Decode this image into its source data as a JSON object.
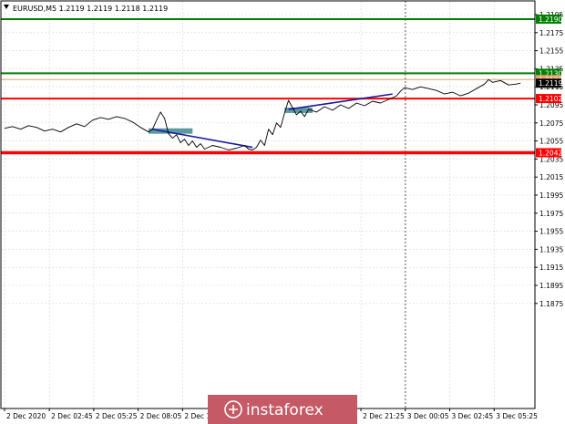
{
  "chart_data": {
    "type": "line",
    "title": "EURUSD,M5  1.2119 1.2119 1.2118 1.2119",
    "symbol_timeframe": "EURUSD,M5",
    "ohlc": [
      "1.2119",
      "1.2119",
      "1.2118",
      "1.2119"
    ],
    "ylim": [
      1.2862,
      1.2209
    ],
    "y_ticks": [
      "1.2195",
      "1.2175",
      "1.2155",
      "1.2135",
      "1.2115",
      "1.2095",
      "1.2075",
      "1.2055",
      "1.2035",
      "1.2015",
      "1.1995",
      "1.1975",
      "1.1955",
      "1.1935",
      "1.1915",
      "1.1895",
      "1.1875"
    ],
    "y_tick_values": [
      1.2195,
      1.2175,
      1.2155,
      1.2135,
      1.2115,
      1.2095,
      1.2075,
      1.2055,
      1.2035,
      1.2015,
      1.1995,
      1.1975,
      1.1955,
      1.1935,
      1.1915,
      1.1895,
      1.1875
    ],
    "x_range": [
      0,
      100
    ],
    "x_ticks": [
      {
        "label": "2 Dec 2020",
        "x": 0
      },
      {
        "label": "2 Dec 02:45",
        "x": 11.2
      },
      {
        "label": "2 Dec 05:25",
        "x": 22.3
      },
      {
        "label": "2 Dec 08:05",
        "x": 33.4
      },
      {
        "label": "2 Dec 10:45",
        "x": 44.5
      },
      {
        "label": "2 Dec 21:25",
        "x": 89.1
      },
      {
        "label": "3 Dec 00:05",
        "x": 100.2
      },
      {
        "label": "3 Dec 02:45",
        "x": 111.3
      },
      {
        "label": "3 Dec 05:25",
        "x": 122.4
      }
    ],
    "x_domain": [
      0,
      131
    ],
    "day_separator_x": 100.2,
    "grid": true,
    "price_series": [
      [
        0,
        1.2069
      ],
      [
        2,
        1.2071
      ],
      [
        4,
        1.2068
      ],
      [
        6,
        1.2072
      ],
      [
        8,
        1.207
      ],
      [
        10,
        1.2066
      ],
      [
        12,
        1.2068
      ],
      [
        14,
        1.2065
      ],
      [
        16,
        1.207
      ],
      [
        18,
        1.2074
      ],
      [
        20,
        1.2071
      ],
      [
        22,
        1.2078
      ],
      [
        24,
        1.2081
      ],
      [
        26,
        1.2079
      ],
      [
        28,
        1.2082
      ],
      [
        30,
        1.208
      ],
      [
        32,
        1.2076
      ],
      [
        34,
        1.207
      ],
      [
        36,
        1.2065
      ],
      [
        37,
        1.2068
      ],
      [
        38,
        1.2078
      ],
      [
        39,
        1.2087
      ],
      [
        40,
        1.208
      ],
      [
        41,
        1.2063
      ],
      [
        42,
        1.2058
      ],
      [
        43,
        1.2062
      ],
      [
        44,
        1.2053
      ],
      [
        45,
        1.2057
      ],
      [
        46,
        1.205
      ],
      [
        47,
        1.2055
      ],
      [
        48,
        1.2048
      ],
      [
        49,
        1.2052
      ],
      [
        50,
        1.2046
      ],
      [
        52,
        1.205
      ],
      [
        54,
        1.2048
      ],
      [
        56,
        1.2045
      ],
      [
        58,
        1.2047
      ],
      [
        60,
        1.205
      ],
      [
        61,
        1.2046
      ],
      [
        62,
        1.2045
      ],
      [
        63,
        1.2048
      ],
      [
        64,
        1.2056
      ],
      [
        65,
        1.205
      ],
      [
        66,
        1.2068
      ],
      [
        67,
        1.2062
      ],
      [
        68,
        1.2075
      ],
      [
        69,
        1.207
      ],
      [
        70,
        1.2086
      ],
      [
        71,
        1.21
      ],
      [
        72,
        1.2092
      ],
      [
        73,
        1.2084
      ],
      [
        74,
        1.2088
      ],
      [
        75,
        1.2082
      ],
      [
        76,
        1.209
      ],
      [
        78,
        1.2087
      ],
      [
        80,
        1.2093
      ],
      [
        82,
        1.2089
      ],
      [
        84,
        1.2095
      ],
      [
        86,
        1.2091
      ],
      [
        88,
        1.2097
      ],
      [
        90,
        1.2094
      ],
      [
        92,
        1.2099
      ],
      [
        94,
        1.2097
      ],
      [
        96,
        1.2101
      ],
      [
        98,
        1.2105
      ],
      [
        99,
        1.211
      ],
      [
        100,
        1.2114
      ],
      [
        102,
        1.2112
      ],
      [
        104,
        1.2115
      ],
      [
        106,
        1.2113
      ],
      [
        108,
        1.2111
      ],
      [
        110,
        1.2107
      ],
      [
        112,
        1.2109
      ],
      [
        114,
        1.2105
      ],
      [
        116,
        1.2108
      ],
      [
        118,
        1.2113
      ],
      [
        120,
        1.2118
      ],
      [
        121,
        1.2123
      ],
      [
        122,
        1.212
      ],
      [
        124,
        1.2122
      ],
      [
        126,
        1.2117
      ],
      [
        128,
        1.2118
      ],
      [
        129,
        1.2119
      ]
    ],
    "levels": [
      {
        "label": "1.2190",
        "value": 1.219,
        "color": "#008000",
        "weight": "medium"
      },
      {
        "label": "1.2130",
        "value": 1.213,
        "color": "#008000",
        "weight": "medium"
      },
      {
        "label": "1.2123",
        "value": 1.2123,
        "color": "#e8a070",
        "weight": "thin"
      },
      {
        "label": "1.2102",
        "value": 1.2102,
        "color": "#ff0000",
        "weight": "medium"
      },
      {
        "label": "1.2042",
        "value": 1.2042,
        "color": "#ff0000",
        "weight": "thick"
      }
    ],
    "current_price": {
      "label": "1.2119",
      "value": 1.2119,
      "color": "#000000"
    },
    "trendlines": [
      {
        "from": [
          37,
          1.2068
        ],
        "to": [
          62,
          1.2048
        ],
        "color": "#1a1aa0"
      },
      {
        "from": [
          71,
          1.209
        ],
        "to": [
          97,
          1.2107
        ],
        "color": "#1a1aa0"
      }
    ],
    "zones": [
      {
        "x": [
          36,
          47
        ],
        "y": [
          1.2069,
          1.2063
        ],
        "color": "#5b9aa0"
      },
      {
        "x": [
          70,
          77
        ],
        "y": [
          1.2092,
          1.2086
        ],
        "color": "#5b9aa0"
      }
    ],
    "watermark": "instaforex",
    "colors": {
      "background": "#ffffff",
      "price": "#000000",
      "grid": "#cfd6dc",
      "watermark_bg": "#c55a66"
    }
  }
}
